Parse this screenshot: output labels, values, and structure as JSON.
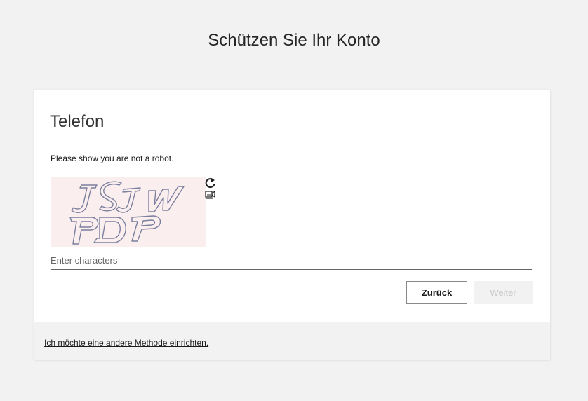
{
  "header": {
    "title": "Schützen Sie Ihr Konto"
  },
  "card": {
    "heading": "Telefon",
    "instruction": "Please show you are not a robot.",
    "captcha": {
      "image_text": "JSJW PDP",
      "refresh_icon": "refresh-icon",
      "audio_icon": "audio-captcha-icon"
    },
    "input": {
      "placeholder": "Enter characters",
      "value": ""
    },
    "buttons": {
      "back": "Zurück",
      "next": "Weiter"
    },
    "footer_link": "Ich möchte eine andere Methode einrichten."
  }
}
